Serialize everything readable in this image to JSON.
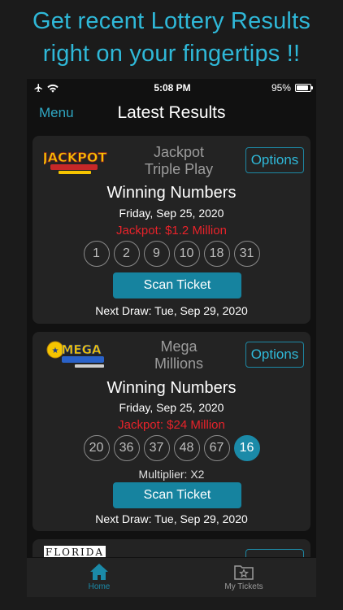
{
  "promo": {
    "line1": "Get recent Lottery Results",
    "line2": "right on your fingertips !!"
  },
  "status_bar": {
    "time": "5:08 PM",
    "battery": "95%",
    "icons": [
      "airplane-icon",
      "wifi-icon",
      "battery-icon"
    ]
  },
  "nav": {
    "menu_label": "Menu",
    "title": "Latest Results"
  },
  "cards": [
    {
      "logo": "jackpot-triple-play-logo",
      "logo_text": "JACKPOT",
      "name_line1": "Jackpot",
      "name_line2": "Triple Play",
      "options_label": "Options",
      "winning_title": "Winning Numbers",
      "draw_date": "Friday, Sep 25, 2020",
      "jackpot": "Jackpot: $1.2 Million",
      "numbers": [
        "1",
        "2",
        "9",
        "10",
        "18",
        "31"
      ],
      "scan_label": "Scan Ticket",
      "next_draw": "Next Draw: Tue, Sep 29, 2020"
    },
    {
      "logo": "mega-millions-logo",
      "logo_text": "MEGA",
      "name_line1": "Mega",
      "name_line2": "Millions",
      "options_label": "Options",
      "winning_title": "Winning Numbers",
      "draw_date": "Friday, Sep 25, 2020",
      "jackpot": "Jackpot: $24 Million",
      "numbers": [
        "20",
        "36",
        "37",
        "48",
        "67"
      ],
      "special_number": "16",
      "multiplier": "Multiplier: X2",
      "scan_label": "Scan Ticket",
      "next_draw": "Next Draw: Tue, Sep 29, 2020"
    },
    {
      "logo": "florida-lottery-logo",
      "logo_text": "FLORIDA"
    }
  ],
  "tabbar": {
    "home_label": "Home",
    "tickets_label": "My Tickets"
  },
  "colors": {
    "accent": "#1b8aa8",
    "accent_text": "#2fb8d8",
    "jackpot_red": "#e8232a",
    "background": "#111111",
    "card": "#232323"
  }
}
